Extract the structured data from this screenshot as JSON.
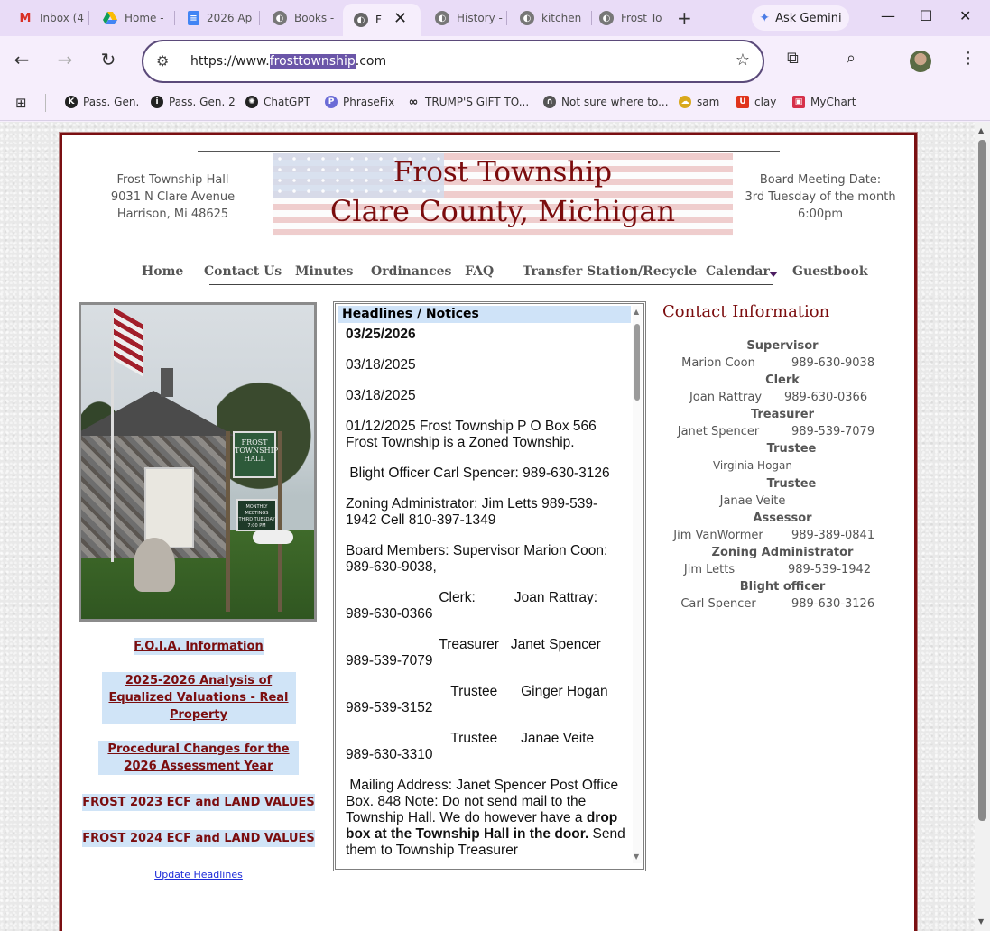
{
  "browser": {
    "tabs": [
      {
        "title": "Inbox (4",
        "icon": "gmail-icon",
        "color": "#d93025"
      },
      {
        "title": "Home -",
        "icon": "google-drive-icon",
        "color": "#1a73e8"
      },
      {
        "title": "2026 Ap",
        "icon": "google-docs-icon",
        "color": "#4285f4"
      },
      {
        "title": "Books -",
        "icon": "globe-icon",
        "color": "#777777"
      },
      {
        "title": "F",
        "icon": "globe-icon",
        "color": "#777777"
      },
      {
        "title": "History -",
        "icon": "globe-icon",
        "color": "#777777"
      },
      {
        "title": "kitchen",
        "icon": "globe-icon",
        "color": "#777777"
      },
      {
        "title": "Frost To",
        "icon": "globe-icon",
        "color": "#777777"
      }
    ],
    "gemini_label": "Ask Gemini",
    "url_prefix": "https://www.",
    "url_host": "frosttownship",
    "url_suffix": ".com",
    "bookmarks": [
      {
        "label": "Pass. Gen.",
        "color": "#222222"
      },
      {
        "label": "Pass. Gen. 2",
        "color": "#222222"
      },
      {
        "label": "ChatGPT",
        "color": "#222222"
      },
      {
        "label": "PhraseFix",
        "color": "#6b6bd6"
      },
      {
        "label": "TRUMP'S GIFT TO...",
        "color": "#222222"
      },
      {
        "label": "Not sure where to...",
        "color": "#555555"
      },
      {
        "label": "sam",
        "color": "#d9a81c"
      },
      {
        "label": "clay",
        "color": "#e0341c"
      },
      {
        "label": "MyChart",
        "color": "#d6304a"
      }
    ]
  },
  "site": {
    "address": [
      "Frost Township Hall",
      "9031 N Clare Avenue",
      "Harrison, Mi  48625"
    ],
    "meeting": [
      "Board Meeting Date:",
      "3rd Tuesday of the month",
      "6:00pm"
    ],
    "banner_line1": "Frost Township",
    "banner_line2": "Clare County, Michigan",
    "nav": [
      "Home",
      "Contact Us",
      "Minutes",
      "Ordinances",
      "FAQ",
      "Transfer Station/Recycle",
      "Calendar",
      "Guestbook"
    ],
    "photo_sign": [
      "FROST",
      "TOWNSHIP",
      "HALL"
    ],
    "photo_sign2": [
      "MONTHLY MEETINGS",
      "THIRD TUESDAY",
      "7:00 PM"
    ],
    "links": [
      "F.O.I.A. Information",
      "2025-2026 Analysis of Equalized Valuations - Real Property",
      "Procedural Changes for the 2026 Assessment Year",
      "FROST 2023 ECF and LAND VALUES",
      "FROST 2024 ECF and LAND VALUES"
    ],
    "update_link": "Update Headlines",
    "headlines_title": "Headlines / Notices",
    "headlines": {
      "d1": "03/25/2026",
      "d2": "03/18/2025",
      "d3": "03/18/2025",
      "p4": "01/12/2025 Frost Township P O Box 566 Frost Township is a Zoned Township.",
      "p5": " Blight Officer Carl Spencer: 989-630-3126",
      "p6": "Zoning Administrator: Jim Letts  989-539-1942 Cell 810-397-1349",
      "p7": "Board Members:  Supervisor Marion Coon: 989-630-9038,",
      "p8": "                        Clerk:          Joan Rattray:   989-630-0366",
      "p9": "                        Treasurer   Janet Spencer  989-539-7079",
      "p10": "                           Trustee      Ginger Hogan   989-539-3152",
      "p11": "                           Trustee      Janae Veite       989-630-3310",
      "p12a": " Mailing Address: Janet Spencer Post Office Box. 848 Note: Do not send mail to the Township Hall. We do however have a ",
      "p12b": "drop box at the Township Hall in the door.",
      "p12c": " Send them to Township Treasurer"
    },
    "contact_title": "Contact Information",
    "contacts": [
      {
        "role": "Supervisor",
        "name": "Marion Coon",
        "phone": "989-630-9038"
      },
      {
        "role": "Clerk",
        "name": "Joan Rattray",
        "phone": "989-630-0366"
      },
      {
        "role": "Treasurer",
        "name": "Janet Spencer",
        "phone": "989-539-7079"
      },
      {
        "role": "Trustee",
        "name": "Virginia Hogan",
        "phone": ""
      },
      {
        "role": "Trustee",
        "name": "Janae Veite",
        "phone": ""
      },
      {
        "role": "Assessor",
        "name": "Jim VanWormer",
        "phone": "989-389-0841"
      },
      {
        "role": "Zoning Administrator",
        "name": "Jim Letts",
        "phone": "989-539-1942"
      },
      {
        "role": "Blight officer",
        "name": "Carl Spencer",
        "phone": "989-630-3126"
      }
    ]
  }
}
